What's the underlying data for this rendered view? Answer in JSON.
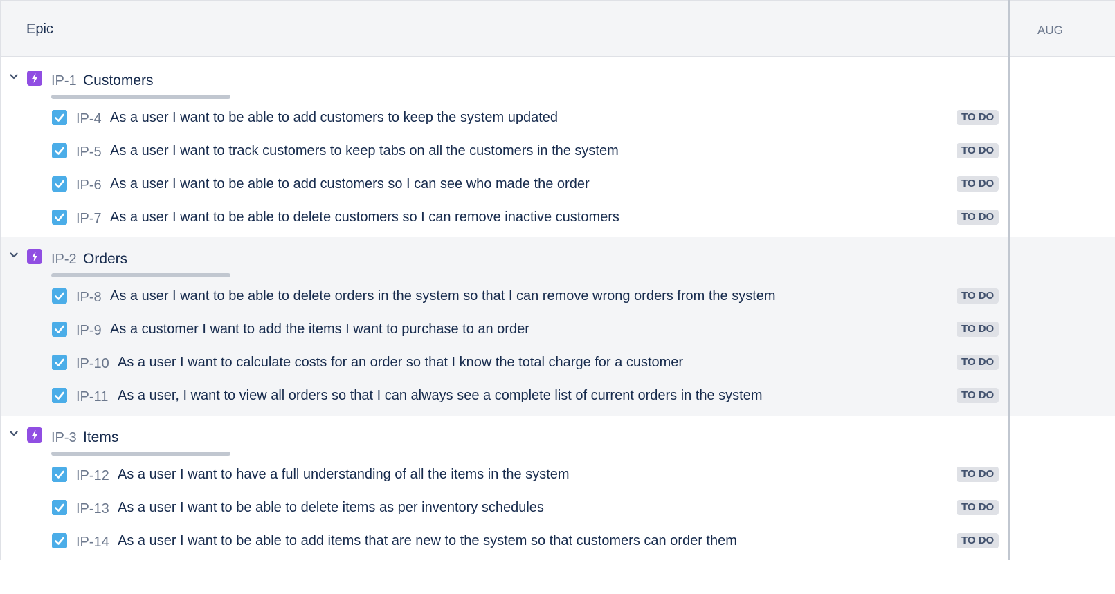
{
  "header": {
    "epic_label": "Epic",
    "month_label": "AUG"
  },
  "colors": {
    "epic_icon": "#904ee2",
    "story_checkbox": "#4bade8",
    "lozenge_bg": "#dfe1e6",
    "alt_row_bg": "#f4f5f7"
  },
  "icons": {
    "expand": "chevron-down-icon",
    "epic": "lightning-icon",
    "story": "checkbox-icon"
  },
  "epics": [
    {
      "key": "IP-1",
      "name": "Customers",
      "stories": [
        {
          "key": "IP-4",
          "summary": "As a user I want to be able to add customers to keep the system updated",
          "status": "TO DO"
        },
        {
          "key": "IP-5",
          "summary": "As a user I want to track customers to keep tabs on all the customers in the system",
          "status": "TO DO"
        },
        {
          "key": "IP-6",
          "summary": "As a user I want to be able to add customers so I can see who made the order",
          "status": "TO DO"
        },
        {
          "key": "IP-7",
          "summary": "As a user I want to be able to delete customers so I can remove inactive customers",
          "status": "TO DO"
        }
      ]
    },
    {
      "key": "IP-2",
      "name": "Orders",
      "stories": [
        {
          "key": "IP-8",
          "summary": "As a user I want to be able to delete orders in the system so that I can remove wrong orders from the system",
          "status": "TO DO"
        },
        {
          "key": "IP-9",
          "summary": "As a customer I want to add the items I want to purchase to an order",
          "status": "TO DO"
        },
        {
          "key": "IP-10",
          "summary": "As a user I want to calculate costs for an order so that I know the total charge for a customer",
          "status": "TO DO"
        },
        {
          "key": "IP-11",
          "summary": "As a user, I want to view all orders so that I can always see a complete list of current orders in the system",
          "status": "TO DO"
        }
      ]
    },
    {
      "key": "IP-3",
      "name": "Items",
      "stories": [
        {
          "key": "IP-12",
          "summary": "As a user I want to have a full understanding of all the items in the system",
          "status": "TO DO"
        },
        {
          "key": "IP-13",
          "summary": "As a user I want to be able to delete items as per inventory schedules",
          "status": "TO DO"
        },
        {
          "key": "IP-14",
          "summary": "As a user I want to be able to add items that are new to the system so that customers can order them",
          "status": "TO DO"
        }
      ]
    }
  ]
}
